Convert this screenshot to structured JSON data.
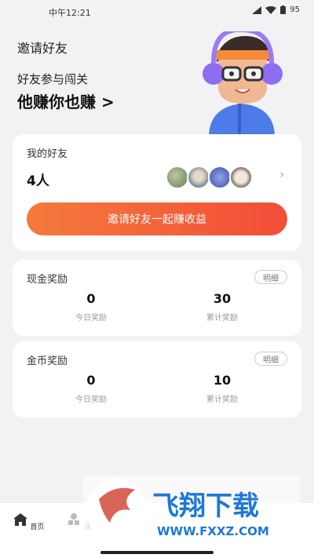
{
  "status_bar": {
    "time": "中午12:21",
    "battery": "95"
  },
  "page": {
    "title": "邀请好友"
  },
  "hero": {
    "subtitle": "好友参与闯关",
    "headline": "他赚你也赚 >"
  },
  "friends_card": {
    "title": "我的好友",
    "count": "4人",
    "invite_button": "邀请好友一起赚收益"
  },
  "cash_card": {
    "title": "现金奖励",
    "detail": "明细",
    "today_value": "0",
    "today_label": "今日奖励",
    "total_value": "30",
    "total_label": "累计奖励"
  },
  "coin_card": {
    "title": "金币奖励",
    "detail": "明细",
    "today_value": "0",
    "today_label": "今日奖励",
    "total_value": "10",
    "total_label": "累计奖励"
  },
  "tabs": [
    {
      "label": "首页"
    },
    {
      "label": "活"
    }
  ],
  "watermark": {
    "brand": "飞翔下载",
    "url": "WWW.FXXZ.COM"
  },
  "colors": {
    "accent_start": "#f57a3c",
    "accent_end": "#f24d38"
  }
}
